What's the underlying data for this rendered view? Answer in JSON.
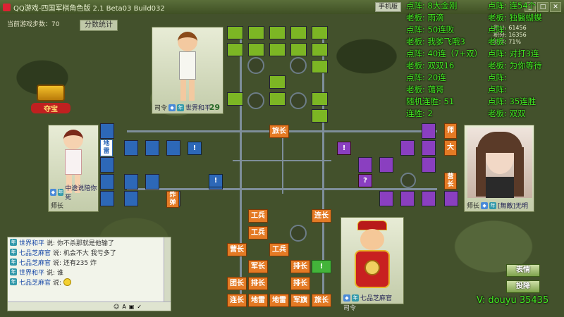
{
  "title": "QQ游戏-四国军棋角色版 2.1 Beta03 Build032",
  "top_buttons": {
    "mobile": "手机版"
  },
  "status": {
    "game_steps": "当前游戏步数：70"
  },
  "stats_button": "分数统计",
  "treasure_label": "夺宝",
  "players": {
    "top": {
      "name": "世界和平",
      "rank": "司令",
      "score": "29",
      "badge": "年"
    },
    "left": {
      "name": "中途说陪你死",
      "rank": "师长",
      "badge": "年"
    },
    "right": {
      "name": "[無敵]无明",
      "rank": "师长",
      "badge": "年"
    },
    "bottom": {
      "name": "七品芝麻官",
      "rank": "司令",
      "badge": "年"
    }
  },
  "right_info": {
    "line1": "积分: 61456",
    "line2": "积分: 16356",
    "line3": "胜率: 71%"
  },
  "pieces": {
    "brigade": "旅长",
    "engineer": "工兵",
    "company": "连长",
    "battalion": "营长",
    "army": "军长",
    "platoon": "排长",
    "regiment": "团长",
    "mine": "地雷",
    "flag": "军旗",
    "division": "师长",
    "bang": "!",
    "q": "?",
    "general": "司令"
  },
  "left_vert_pieces": {
    "p1": "地雷",
    "p2": "炸弹"
  },
  "right_vert_pieces": {
    "p1": "师",
    "p2": "大",
    "p3": "营长"
  },
  "chat": {
    "lines": [
      {
        "who": "世界和平",
        "say": "说: 你不杀那就是他输了"
      },
      {
        "who": "七品芝麻官",
        "say": "说: 机会不大  我亏多了"
      },
      {
        "who": "七品芝麻官",
        "say": "说: 还有235 炸"
      },
      {
        "who": "世界和平",
        "say": "说: 谁"
      },
      {
        "who": "七品芝麻官",
        "say": "说:"
      }
    ]
  },
  "buttons": {
    "emote": "表情",
    "surrender": "投降"
  },
  "overlay_left": [
    "点阵: 8大金刚",
    "老板: 雨滴",
    "点阵: 50连败",
    "老板: 我爹飞哦3",
    "点阵: 40连（7+双）",
    "老板: 双双16",
    "点阵: 20连",
    "老板: 蔼哥",
    "随机连胜: 51",
    "连胜: 2"
  ],
  "overlay_right": [
    "点阵: 连54个",
    "老板: 独醫蝴蝶",
    "点阵:",
    "老板:",
    "点阵: 对打3连",
    "老板: 为你等待",
    "点阵:",
    "点阵:",
    "点阵: 35连胜",
    "老板: 双双"
  ],
  "watermark": "V: douyu 35435"
}
